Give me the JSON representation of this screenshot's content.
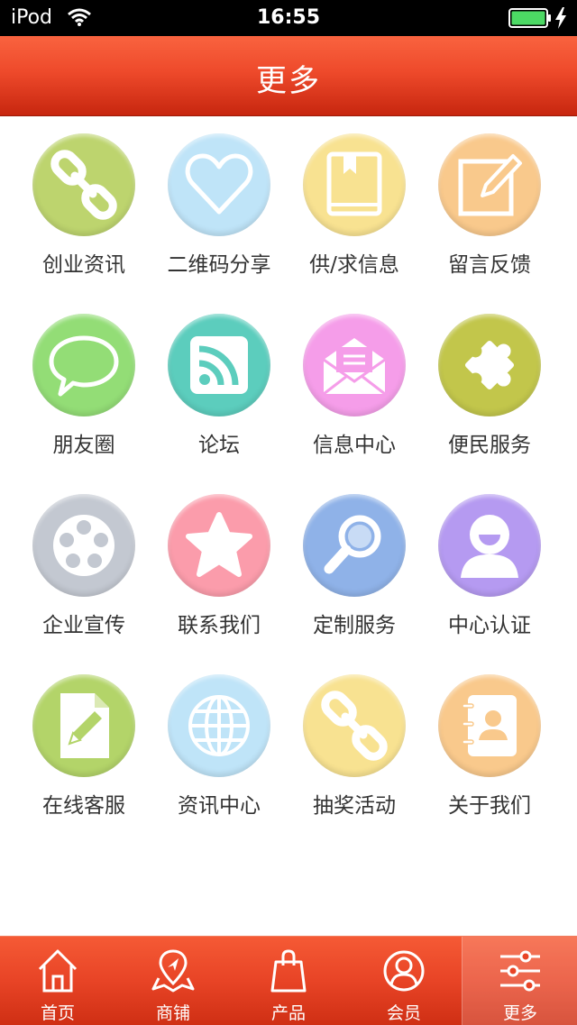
{
  "status_bar": {
    "carrier": "iPod",
    "time": "16:55"
  },
  "header": {
    "title": "更多"
  },
  "grid": {
    "items": [
      {
        "label": "创业资讯",
        "icon": "link-icon",
        "color": "#bdd46e"
      },
      {
        "label": "二维码分享",
        "icon": "heart-icon",
        "color": "#bfe4f8"
      },
      {
        "label": "供/求信息",
        "icon": "book-icon",
        "color": "#f8e291"
      },
      {
        "label": "留言反馈",
        "icon": "edit-icon",
        "color": "#f9c98c"
      },
      {
        "label": "朋友圈",
        "icon": "chat-bubble-icon",
        "color": "#93dd76"
      },
      {
        "label": "论坛",
        "icon": "rss-icon",
        "color": "#5ccdbd"
      },
      {
        "label": "信息中心",
        "icon": "envelope-icon",
        "color": "#f59de9"
      },
      {
        "label": "便民服务",
        "icon": "puzzle-icon",
        "color": "#c2c64b"
      },
      {
        "label": "企业宣传",
        "icon": "film-reel-icon",
        "color": "#c3c8d1"
      },
      {
        "label": "联系我们",
        "icon": "star-icon",
        "color": "#fb9cab"
      },
      {
        "label": "定制服务",
        "icon": "magnifier-icon",
        "color": "#8fb2e8"
      },
      {
        "label": "中心认证",
        "icon": "user-icon",
        "color": "#b59af1"
      },
      {
        "label": "在线客服",
        "icon": "document-edit-icon",
        "color": "#b3d469"
      },
      {
        "label": "资讯中心",
        "icon": "globe-icon",
        "color": "#bfe4f8"
      },
      {
        "label": "抽奖活动",
        "icon": "link-icon",
        "color": "#f8e291"
      },
      {
        "label": "关于我们",
        "icon": "contacts-book-icon",
        "color": "#f9c98c"
      }
    ]
  },
  "tab_bar": {
    "tabs": [
      {
        "label": "首页",
        "icon": "home-icon",
        "active": false
      },
      {
        "label": "商铺",
        "icon": "map-location-icon",
        "active": false
      },
      {
        "label": "产品",
        "icon": "shopping-bag-icon",
        "active": false
      },
      {
        "label": "会员",
        "icon": "user-circle-icon",
        "active": false
      },
      {
        "label": "更多",
        "icon": "sliders-icon",
        "active": true
      }
    ]
  },
  "colors": {
    "header_red": "#e84426",
    "tab_red": "#e84426",
    "text": "#333333",
    "tab_text": "#ffffff"
  }
}
